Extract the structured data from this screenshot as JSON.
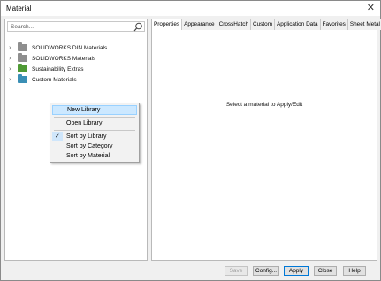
{
  "window": {
    "title": "Material",
    "close_glyph": "✕"
  },
  "search": {
    "placeholder": "Search..."
  },
  "tree": {
    "items": [
      {
        "label": "SOLIDWORKS DIN Materials",
        "icon": "folder-grey-icon"
      },
      {
        "label": "SOLIDWORKS Materials",
        "icon": "folder-grey-icon"
      },
      {
        "label": "Sustainability Extras",
        "icon": "folder-green-icon"
      },
      {
        "label": "Custom Materials",
        "icon": "folder-teal-icon"
      }
    ]
  },
  "context_menu": {
    "items": [
      {
        "label": "New Library",
        "highlighted": true
      },
      {
        "label": "Open Library"
      },
      {
        "label": "Sort by Library",
        "checked": true
      },
      {
        "label": "Sort by Category"
      },
      {
        "label": "Sort by Material"
      }
    ],
    "check_glyph": "✓"
  },
  "tabs": [
    "Properties",
    "Appearance",
    "CrossHatch",
    "Custom",
    "Application Data",
    "Favorites",
    "Sheet Metal"
  ],
  "message": "Select a material to Apply/Edit",
  "buttons": {
    "save": "Save",
    "config": "Config...",
    "apply": "Apply",
    "close": "Close",
    "help": "Help"
  },
  "colors": {
    "highlight": "#cce8ff",
    "folder_grey": "#8e8e8e",
    "folder_green": "#4f9a35",
    "folder_teal": "#3a8fb5",
    "default_button_border": "#0078d7"
  }
}
